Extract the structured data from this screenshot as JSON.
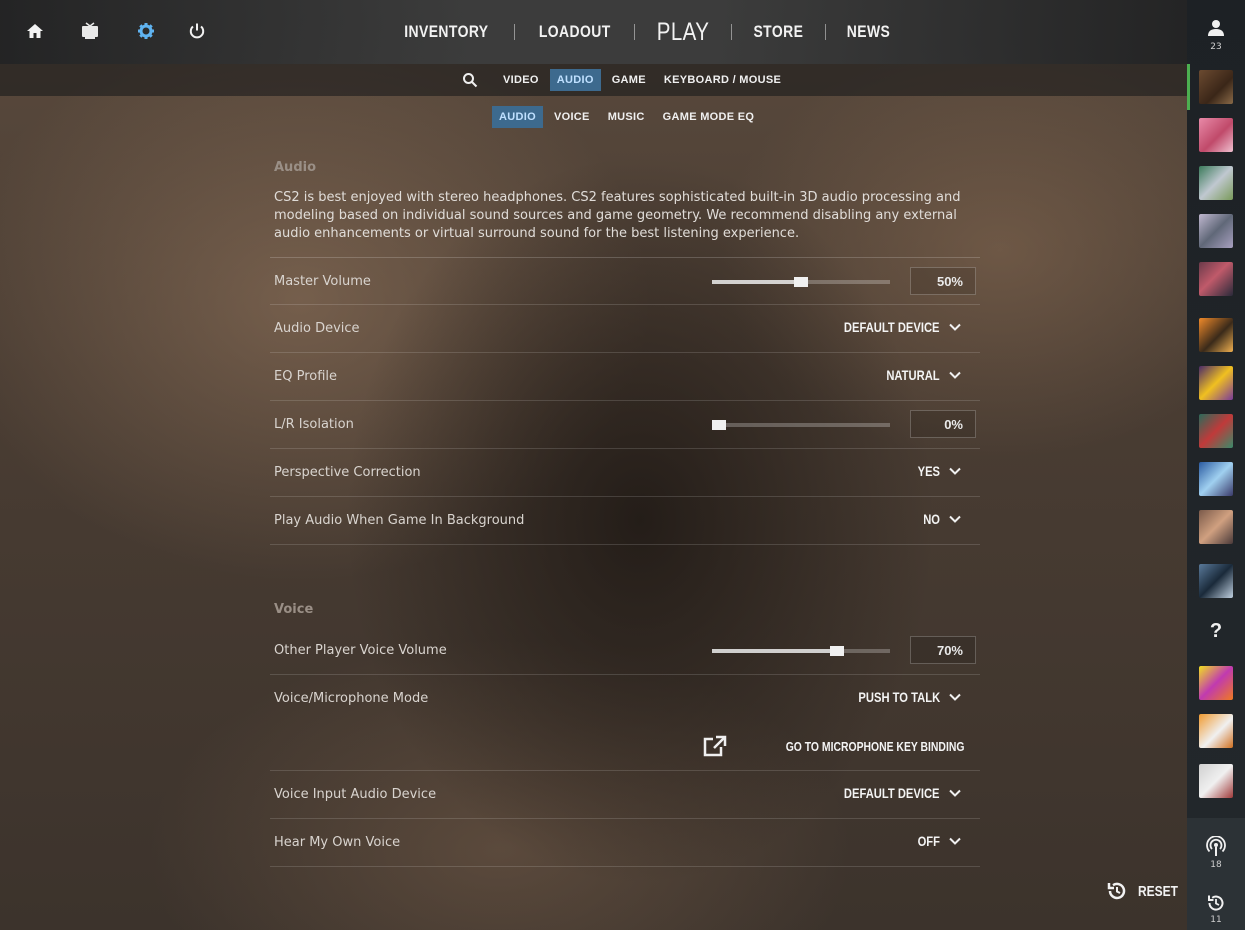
{
  "topbar": {
    "icons": [
      "home-icon",
      "tv-icon",
      "gear-icon",
      "power-icon"
    ],
    "nav": [
      {
        "label": "INVENTORY"
      },
      {
        "label": "LOADOUT"
      },
      {
        "label": "PLAY"
      },
      {
        "label": "STORE"
      },
      {
        "label": "NEWS"
      }
    ]
  },
  "tabs": {
    "main": [
      "VIDEO",
      "AUDIO",
      "GAME",
      "KEYBOARD / MOUSE"
    ],
    "main_active": "AUDIO",
    "sub": [
      "AUDIO",
      "VOICE",
      "MUSIC",
      "GAME MODE EQ"
    ],
    "sub_active": "AUDIO"
  },
  "audio": {
    "title": "Audio",
    "description": "CS2 is best enjoyed with stereo headphones. CS2 features sophisticated built-in 3D audio processing and modeling based on individual sound sources and game geometry. We recommend disabling any external audio enhancements or virtual surround sound for the best listening experience.",
    "master_volume": {
      "label": "Master Volume",
      "value": "50%",
      "fraction": 0.5
    },
    "audio_device": {
      "label": "Audio Device",
      "value": "DEFAULT DEVICE"
    },
    "eq_profile": {
      "label": "EQ Profile",
      "value": "NATURAL"
    },
    "lr_isolation": {
      "label": "L/R Isolation",
      "value": "0%",
      "fraction": 0.0
    },
    "perspective": {
      "label": "Perspective Correction",
      "value": "YES"
    },
    "background": {
      "label": "Play Audio When Game In Background",
      "value": "NO"
    }
  },
  "voice": {
    "title": "Voice",
    "other_volume": {
      "label": "Other Player Voice Volume",
      "value": "70%",
      "fraction": 0.7
    },
    "mic_mode": {
      "label": "Voice/Microphone Mode",
      "value": "PUSH TO TALK"
    },
    "mic_binding": "GO TO MICROPHONE KEY BINDING",
    "input_device": {
      "label": "Voice Input Audio Device",
      "value": "DEFAULT DEVICE"
    },
    "hear_own": {
      "label": "Hear My Own Voice",
      "value": "OFF"
    }
  },
  "reset_label": "RESET",
  "rightbar": {
    "friends_count": "23",
    "broadcast_count": "18",
    "history_count": "11",
    "unknown_glyph": "?"
  },
  "colors": {
    "accent_tab": "#3d6a8e",
    "online_indicator": "#4caf50"
  }
}
